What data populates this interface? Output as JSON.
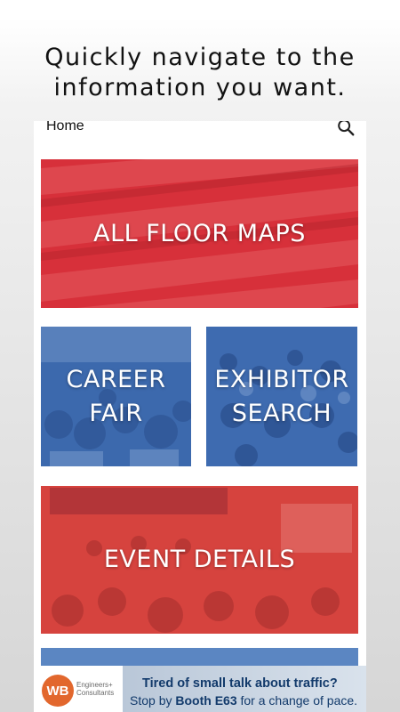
{
  "headline": {
    "line1": "Quickly navigate to the",
    "line2": "information you want."
  },
  "appbar": {
    "title": "Home",
    "search_icon": "search-icon"
  },
  "tiles": [
    {
      "label": "ALL FLOOR MAPS",
      "color": "#d9333c"
    },
    {
      "label_line1": "CAREER",
      "label_line2": "FAIR",
      "color": "#3f6fb3"
    },
    {
      "label_line1": "EXHIBITOR",
      "label_line2": "SEARCH",
      "color": "#3f6fb3"
    },
    {
      "label": "EVENT DETAILS",
      "color": "#d84a44"
    }
  ],
  "ad": {
    "logo_mark": "WB",
    "logo_line1": "Engineers+",
    "logo_line2": "Consultants",
    "line1": "Tired of small talk about traffic?",
    "line2_pre": "Stop by ",
    "line2_booth": "Booth E63",
    "line2_post": " for a change of pace.",
    "accent": "#e2672d",
    "text_color": "#123a6b"
  }
}
